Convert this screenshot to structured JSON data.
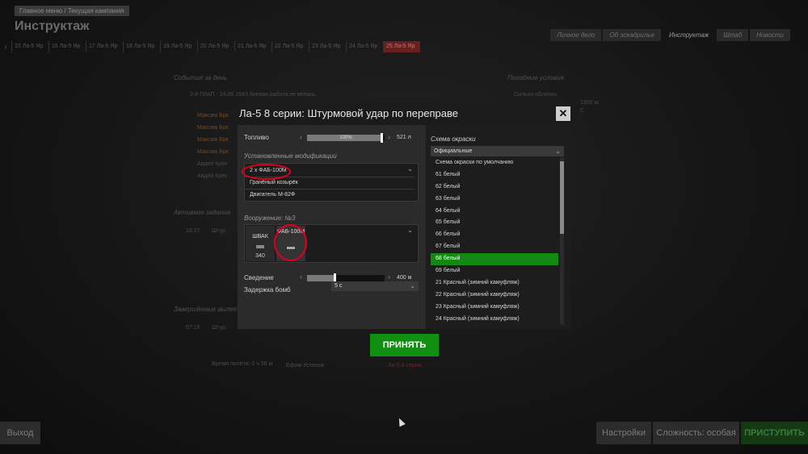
{
  "background": {
    "breadcrumb": "Главное меню / Текущая кампания",
    "title": "Инструктаж",
    "tabs": [
      "Личное дело",
      "Об эскадрилье",
      "Инструктаж",
      "Штаб",
      "Новости"
    ],
    "active_tab": "Инструктаж",
    "timeline": [
      "15 Ла-5 Яр",
      "16 Ла-5 Яр",
      "17 Ла-5 Яр",
      "18 Ла-5 Яр",
      "19 Ла-5 Яр",
      "20 Ла-5 Яр",
      "21 Ла-5 Яр",
      "22 Ла-5 Яр",
      "23 Ла-5 Яр",
      "24 Ла-5 Яр",
      "25 Ла-5 Яр"
    ],
    "events_heading": "События за день",
    "weather_heading": "Погодные условия",
    "events_first": "3-й ГИАП - 24.06.1943 боевая работа не велась.",
    "pilots": [
      "Максим Брк",
      "Максим Брк",
      "Максим Брк",
      "Максим Брк",
      "Авдей Крек",
      "Авдей Крек"
    ],
    "weather": [
      "Сильно облачно",
      "1300 м",
      "С"
    ],
    "active_task_heading": "Активное задание",
    "active_task_time": "18:27",
    "active_task_text": "Штур",
    "completed_heading": "Завершённые вылеты",
    "completed_time": "07:15",
    "completed_text": "Штур",
    "flight_time": "Время полёта: 0 ч 56 м",
    "pilot_name": "Ефим Устинов",
    "plane_name": "Ла-5 8 серии",
    "btn_exit": "Выход",
    "btn_settings": "Настройки",
    "btn_difficulty": "Сложность: особая",
    "btn_start": "ПРИСТУПИТЬ"
  },
  "modal": {
    "title": "Ла-5 8 серии: Штурмовой удар по переправе",
    "fuel_label": "Топливо",
    "fuel_percent": "100%",
    "fuel_fraction": 0.97,
    "fuel_value": "521 л",
    "mods_heading": "Установленные модификации",
    "mods": [
      "2 х ФАБ-100М",
      "Гранёный козырёк",
      "Двигатель М-82Ф"
    ],
    "armament_heading": "Вооружение: №3",
    "weapons": [
      {
        "name": "ШВАК",
        "count": "340"
      },
      {
        "name": "ФАБ-100М",
        "count": ""
      }
    ],
    "convergence_label": "Сведение",
    "convergence_fraction": 0.36,
    "convergence_value": "400 м",
    "bomb_delay_label": "Задержка бомб",
    "bomb_delay_value": "5 с",
    "scheme_heading": "Схема окраски",
    "scheme_select": "Официальные",
    "schemes": [
      "Схема окраски по умолчанию",
      "61 белый",
      "62 белый",
      "63 белый",
      "64 белый",
      "65 белый",
      "66 белый",
      "67 белый",
      "68 белый",
      "69 белый",
      "21 Красный (зимний камуфляж)",
      "22 Красный (зимний камуфляж)",
      "23 Красный (зимний камуфляж)",
      "24 Красный (зимний камуфляж)"
    ],
    "selected_scheme": "68 белый",
    "accept_label": "ПРИНЯТЬ"
  },
  "colors": {
    "accent_green": "#108f10",
    "highlight_red": "#e0001a"
  }
}
